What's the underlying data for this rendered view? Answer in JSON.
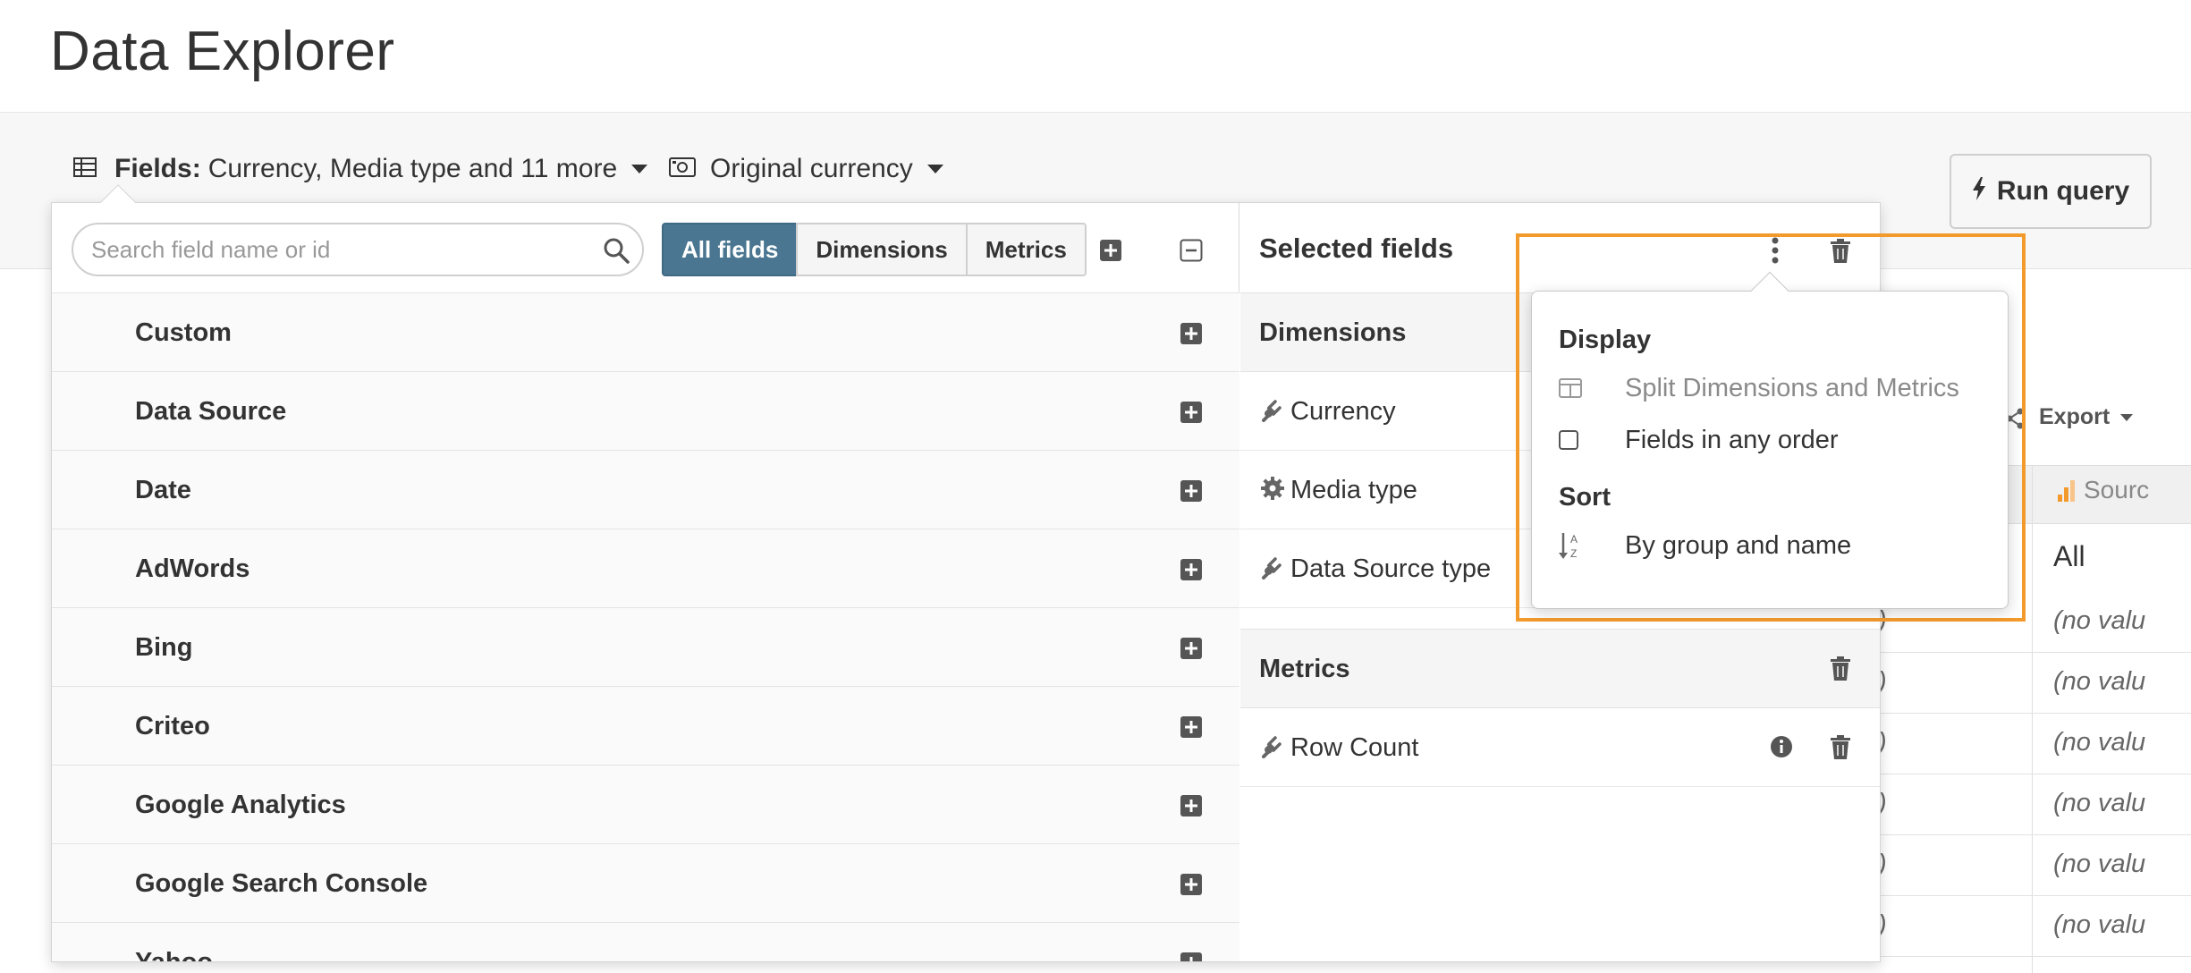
{
  "page": {
    "title": "Data Explorer"
  },
  "toolbar": {
    "fields_label": "Fields:",
    "fields_value": "Currency, Media type and 11 more",
    "currency_value": "Original currency",
    "run_label": "Run query"
  },
  "panel": {
    "search": {
      "placeholder": "Search field name or id",
      "value": ""
    },
    "filters": [
      "All fields",
      "Dimensions",
      "Metrics"
    ],
    "active_filter": "All fields",
    "groups": [
      "Custom",
      "Data Source",
      "Date",
      "AdWords",
      "Bing",
      "Criteo",
      "Google Analytics",
      "Google Search Console",
      "Yahoo"
    ]
  },
  "selected": {
    "title": "Selected fields",
    "dimensions_heading": "Dimensions",
    "dimensions": [
      {
        "name": "Currency",
        "icon": "plug-icon"
      },
      {
        "name": "Media type",
        "icon": "gear-icon"
      },
      {
        "name": "Data Source type",
        "icon": "plug-icon"
      }
    ],
    "metrics_heading": "Metrics",
    "metrics": [
      {
        "name": "Row Count",
        "icon": "plug-icon"
      }
    ]
  },
  "menu": {
    "display_heading": "Display",
    "split_label": "Split Dimensions and Metrics",
    "any_order_label": "Fields in any order",
    "sort_heading": "Sort",
    "sort_label": "By group and name"
  },
  "results": {
    "export_label": "Export",
    "source_header": "Sourc",
    "all_value": "All",
    "no_value": "(no valu",
    "paren": ")"
  },
  "colors": {
    "accent": "#4a7691",
    "highlight": "#f39a2c"
  }
}
